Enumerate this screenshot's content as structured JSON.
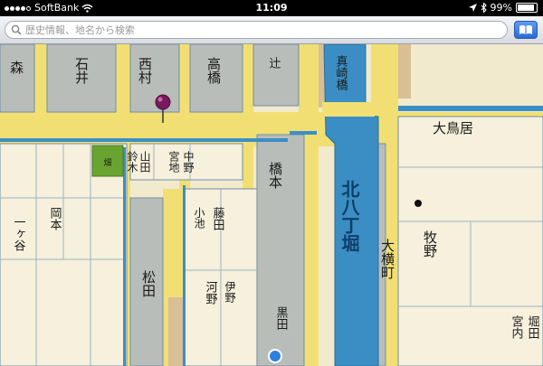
{
  "status_bar": {
    "carrier": "SoftBank",
    "time": "11:09",
    "battery": "99%",
    "battery_level": 0.99,
    "signal_bars": 4,
    "icons": [
      "wifi-icon",
      "location-arrow-icon",
      "bluetooth-icon",
      "battery-icon"
    ]
  },
  "search": {
    "placeholder": "歴史情報、地名から検索",
    "value": "",
    "icon": "search-icon",
    "bookmark_icon": "book-icon"
  },
  "map": {
    "labels": {
      "moat": "北八丁堀",
      "bridge": "真崎橋",
      "town_street": "大横町",
      "ishimura": "石井",
      "nishimura": "西村",
      "mori": "森",
      "takahashi": "高橋",
      "miyaji": "宮地",
      "nakano": "中野",
      "yamada": "山田",
      "sukizuki": "鈴木",
      "tsuji": "辻",
      "hashimoto": "橋本",
      "fujita": "藤田",
      "koike": "小池",
      "matsuda": "松田",
      "kawano": "河野",
      "ino": "伊野",
      "ootomo": "大鳥居",
      "okamoto": "岡本",
      "ichigaya": "一ヶ谷",
      "makino": "牧野",
      "miyauchi": "宮内",
      "hotta": "堀田",
      "kuroda": "黒田"
    },
    "green_plot_label": "畑",
    "marker_icon": "map-pin-icon",
    "current_location_icon": "current-location-icon"
  }
}
